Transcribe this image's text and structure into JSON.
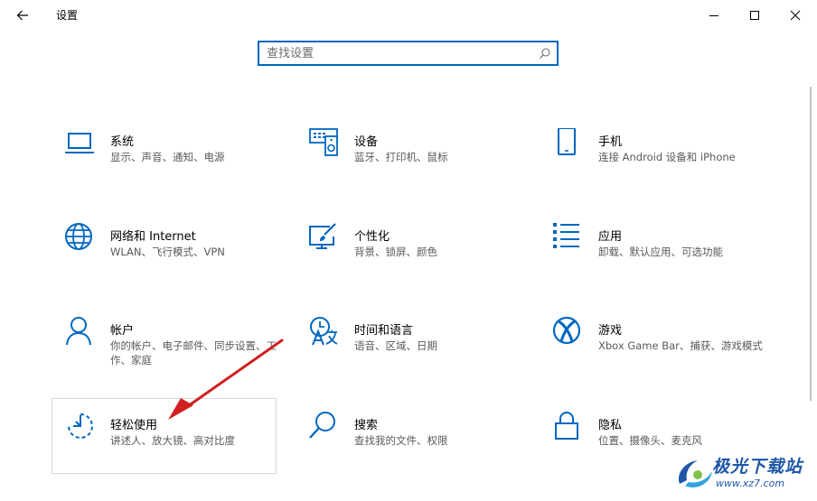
{
  "window": {
    "title": "设置",
    "back_icon": "back-arrow-icon",
    "controls": [
      "minimize-icon",
      "maximize-icon",
      "close-icon"
    ]
  },
  "search": {
    "placeholder": "查找设置",
    "value": "",
    "icon": "search-icon"
  },
  "colors": {
    "accent": "#0067c0",
    "arrow": "#d11f1f"
  },
  "tiles": [
    {
      "name": "系统",
      "desc": "显示、声音、通知、电源",
      "icon": "laptop-icon"
    },
    {
      "name": "设备",
      "desc": "蓝牙、打印机、鼠标",
      "icon": "keyboard-speaker-icon"
    },
    {
      "name": "手机",
      "desc": "连接 Android 设备和 iPhone",
      "icon": "phone-icon"
    },
    {
      "name": "网络和 Internet",
      "desc": "WLAN、飞行模式、VPN",
      "icon": "globe-icon"
    },
    {
      "name": "个性化",
      "desc": "背景、锁屏、颜色",
      "icon": "paint-monitor-icon"
    },
    {
      "name": "应用",
      "desc": "卸载、默认应用、可选功能",
      "icon": "list-icon"
    },
    {
      "name": "帐户",
      "desc": "你的帐户、电子邮件、同步设置、工作、家庭",
      "icon": "person-icon"
    },
    {
      "name": "时间和语言",
      "desc": "语音、区域、日期",
      "icon": "time-language-icon"
    },
    {
      "name": "游戏",
      "desc": "Xbox Game Bar、捕获、游戏模式",
      "icon": "xbox-icon"
    },
    {
      "name": "轻松使用",
      "desc": "讲述人、放大镜、高对比度",
      "icon": "ease-of-access-icon"
    },
    {
      "name": "搜索",
      "desc": "查找我的文件、权限",
      "icon": "magnifier-icon"
    },
    {
      "name": "隐私",
      "desc": "位置、摄像头、麦克风",
      "icon": "lock-icon"
    }
  ],
  "watermark": {
    "text": "极光下载站",
    "url": "www.xz7.com"
  }
}
